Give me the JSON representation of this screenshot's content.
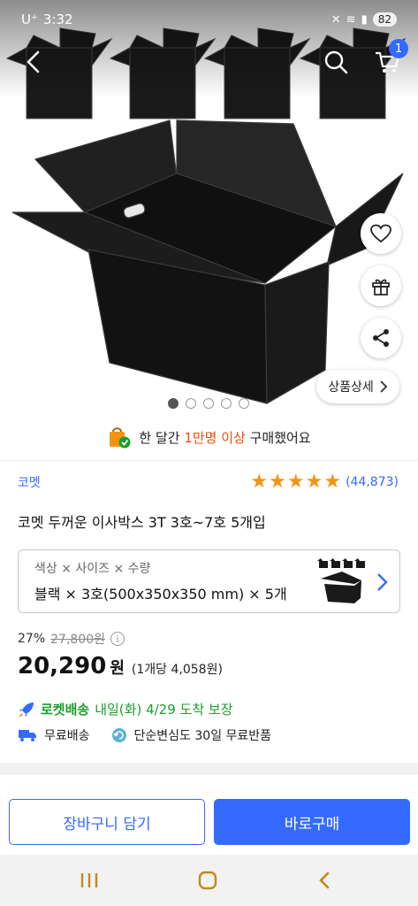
{
  "status_bar": {
    "carrier": "U⁺",
    "time": "3:32",
    "battery": "82"
  },
  "nav": {
    "cart_count": "1"
  },
  "hero": {
    "detail_button_label": "상품상세",
    "image_count": 5,
    "active_image_index": 0
  },
  "promo": {
    "prefix": "한 달간 ",
    "highlight": "1만명 이상",
    "suffix": " 구매했어요"
  },
  "product": {
    "seller": "코멧",
    "rating_stars": 5,
    "review_count": "(44,873)",
    "title": "코멧 두꺼운 이사박스 3T 3호~7호 5개입"
  },
  "option": {
    "label": "색상 × 사이즈 × 수량",
    "value": "블랙 × 3호(500x350x350 mm) × 5개"
  },
  "price": {
    "discount_rate": "27%",
    "original_price": "27,800원",
    "final_price": "20,290",
    "currency": "원",
    "unit_price": "(1개당 4,058원)"
  },
  "delivery": {
    "rocket_brand": "로켓배송",
    "arrival": "내일(화) 4/29 도착 보장",
    "free_shipping": "무료배송",
    "free_return": "단순변심도 30일 무료반품"
  },
  "actions": {
    "add_to_cart": "장바구니 담기",
    "buy_now": "바로구매"
  },
  "colors": {
    "accent": "#346aff",
    "rating": "#f39414",
    "rocket": "#1b9f2c",
    "promo_highlight": "#e5500a"
  },
  "icons": [
    "back-icon",
    "search-icon",
    "cart-icon",
    "heart-icon",
    "gift-icon",
    "share-icon",
    "chevron-right-icon",
    "info-icon",
    "rocket-icon",
    "truck-icon",
    "return-icon"
  ]
}
